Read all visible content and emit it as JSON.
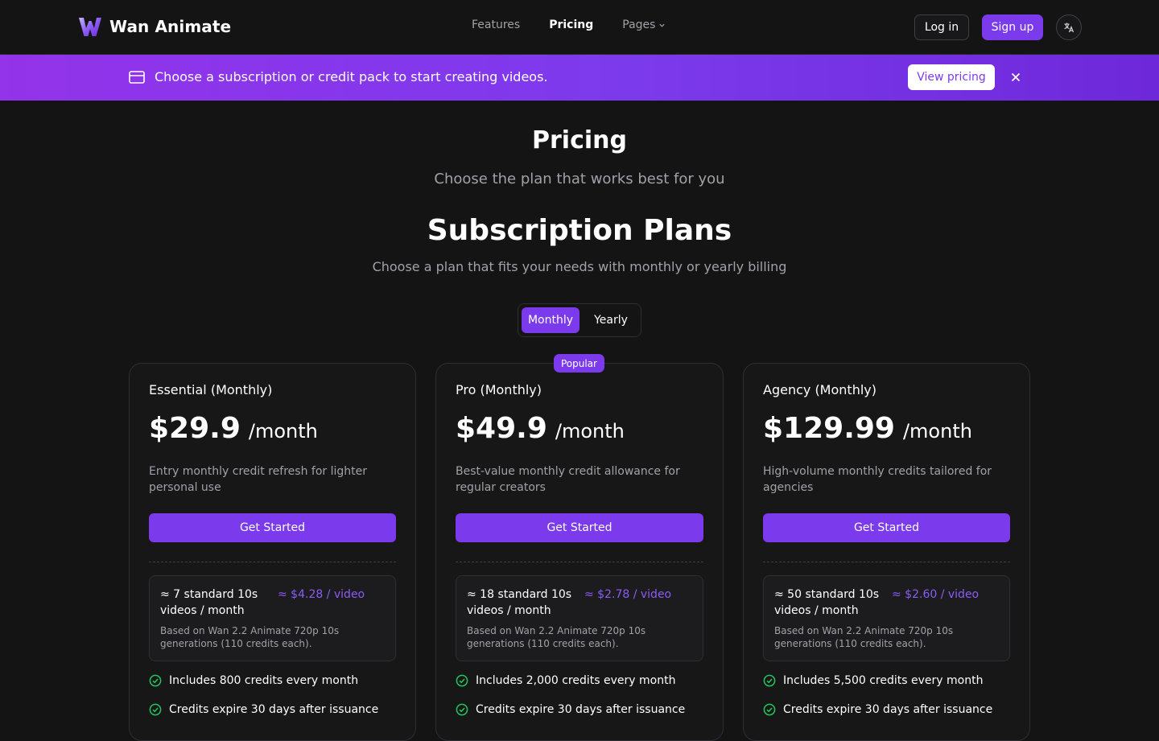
{
  "brand": {
    "name": "Wan Animate",
    "logo_icon": "w-logo-icon"
  },
  "nav": {
    "features": "Features",
    "pricing": "Pricing",
    "pages": "Pages"
  },
  "header": {
    "login": "Log in",
    "signup": "Sign up",
    "language_icon": "translate-icon"
  },
  "banner": {
    "text": "Choose a subscription or credit pack to start creating videos.",
    "button": "View pricing",
    "icon": "credit-card-icon",
    "close_icon": "close-icon"
  },
  "page": {
    "title": "Pricing",
    "subtitle": "Choose the plan that works best for you",
    "section_title": "Subscription Plans",
    "section_subtitle": "Choose a plan that fits your needs with monthly or yearly billing"
  },
  "billing_toggle": {
    "monthly": "Monthly",
    "yearly": "Yearly",
    "selected": "Monthly"
  },
  "colors": {
    "accent": "#7c3aed",
    "accent_text": "#8b5cf6",
    "check": "#22c55e",
    "background": "#141414"
  },
  "plans": [
    {
      "name": "Essential (Monthly)",
      "price": "$29.9",
      "period": "/month",
      "description": "Entry monthly credit refresh for lighter personal use",
      "cta": "Get Started",
      "videos": "≈ 7 standard 10s videos / month",
      "rate": "≈ $4.28 / video",
      "note": "Based on Wan 2.2 Animate 720p 10s generations (110 credits each).",
      "features": [
        "Includes 800 credits every month",
        "Credits expire 30 days after issuance"
      ]
    },
    {
      "name": "Pro (Monthly)",
      "badge": "Popular",
      "price": "$49.9",
      "period": "/month",
      "description": "Best-value monthly credit allowance for regular creators",
      "cta": "Get Started",
      "videos": "≈ 18 standard 10s videos / month",
      "rate": "≈ $2.78 / video",
      "note": "Based on Wan 2.2 Animate 720p 10s generations (110 credits each).",
      "features": [
        "Includes 2,000 credits every month",
        "Credits expire 30 days after issuance"
      ]
    },
    {
      "name": "Agency (Monthly)",
      "price": "$129.99",
      "period": "/month",
      "description": "High-volume monthly credits tailored for agencies",
      "cta": "Get Started",
      "videos": "≈ 50 standard 10s videos / month",
      "rate": "≈ $2.60 / video",
      "note": "Based on Wan 2.2 Animate 720p 10s generations (110 credits each).",
      "features": [
        "Includes 5,500 credits every month",
        "Credits expire 30 days after issuance"
      ]
    }
  ]
}
